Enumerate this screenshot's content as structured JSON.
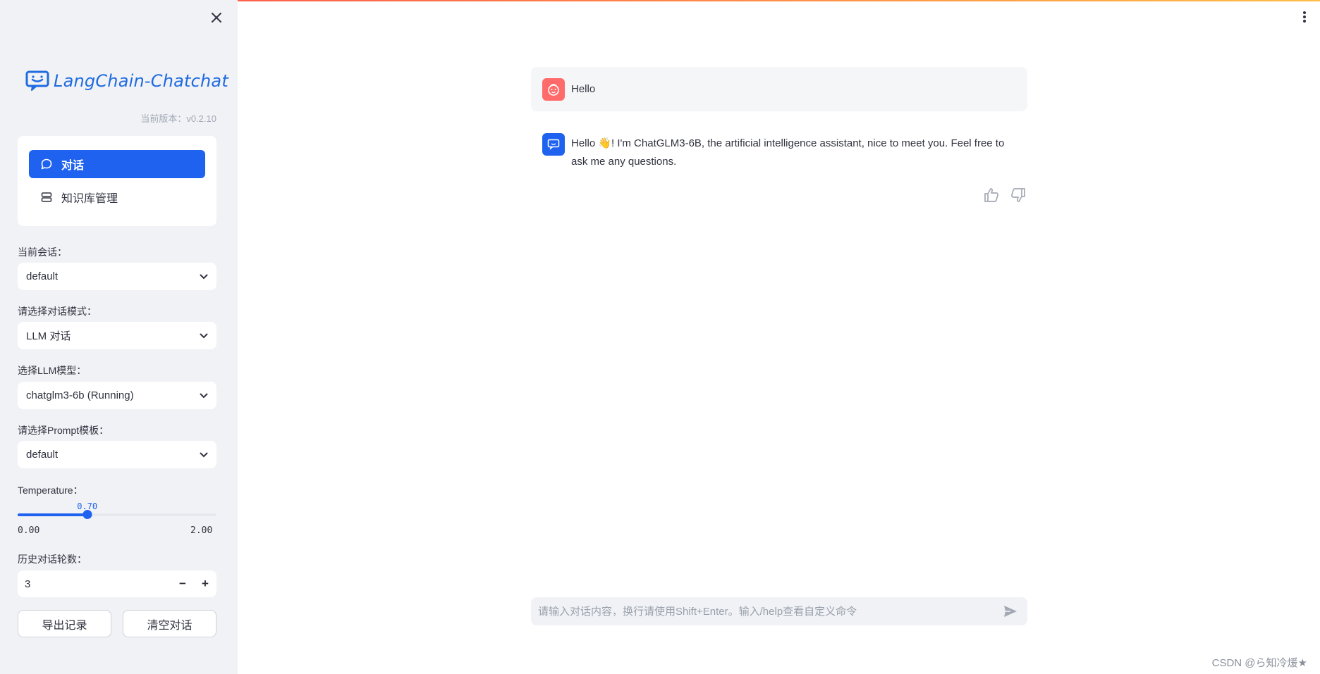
{
  "sidebar": {
    "logo_text": "LangChain-Chatchat",
    "version": "当前版本：v0.2.10",
    "nav": [
      {
        "label": "对话",
        "icon": "chat-bubble-icon",
        "active": true
      },
      {
        "label": "知识库管理",
        "icon": "database-icon",
        "active": false
      }
    ],
    "current_session": {
      "label": "当前会话：",
      "value": "default"
    },
    "dialog_mode": {
      "label": "请选择对话模式：",
      "value": "LLM 对话"
    },
    "llm_model": {
      "label": "选择LLM模型：",
      "value": "chatglm3-6b (Running)"
    },
    "prompt_template": {
      "label": "请选择Prompt模板：",
      "value": "default"
    },
    "temperature": {
      "label": "Temperature：",
      "value": 0.7,
      "value_text": "0.70",
      "min": 0,
      "max": 2,
      "min_text": "0.00",
      "max_text": "2.00"
    },
    "history_rounds": {
      "label": "历史对话轮数：",
      "value": "3",
      "minus": "−",
      "plus": "+"
    },
    "export_button": "导出记录",
    "clear_button": "清空对话"
  },
  "chat": {
    "messages": [
      {
        "role": "user",
        "text": "Hello"
      },
      {
        "role": "assistant",
        "text": "Hello 👋! I'm ChatGLM3-6B, the artificial intelligence assistant, nice to meet you. Feel free to ask me any questions."
      }
    ],
    "input_placeholder": "请输入对话内容，换行请使用Shift+Enter。输入/help查看自定义命令"
  },
  "watermark": "CSDN @ら知冷煖★",
  "colors": {
    "accent": "#1e62ef",
    "sidebar_bg": "#f0f2f6",
    "user_avatar": "#ff6b6b"
  }
}
